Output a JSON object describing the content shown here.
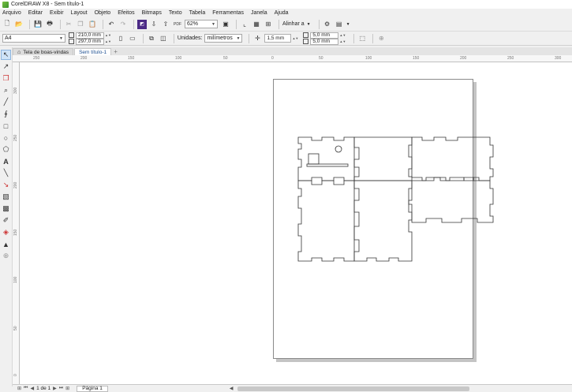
{
  "window": {
    "title": "CorelDRAW X8 - Sem título-1"
  },
  "menu": [
    "Arquivo",
    "Editar",
    "Exibir",
    "Layout",
    "Objeto",
    "Efeitos",
    "Bitmaps",
    "Texto",
    "Tabela",
    "Ferramentas",
    "Janela",
    "Ajuda"
  ],
  "toolbar": {
    "zoom_value": "62%",
    "align_label": "Alinhar a"
  },
  "property_bar": {
    "page_size": "A4",
    "width": "210,0 mm",
    "height": "297,0 mm",
    "units_label": "Unidades:",
    "units_value": "milímetros",
    "nudge": "1,5 mm",
    "dup_x": "5,0 mm",
    "dup_y": "5,0 mm"
  },
  "tabs": [
    {
      "label": "Tela de boas-vindas",
      "active": false
    },
    {
      "label": "Sem título-1",
      "active": true
    }
  ],
  "ruler_h": [
    "250",
    "200",
    "150",
    "100",
    "50",
    "0",
    "50",
    "100",
    "150",
    "200",
    "250",
    "300"
  ],
  "ruler_v": [
    "300",
    "250",
    "200",
    "150",
    "100",
    "50",
    "0"
  ],
  "status": {
    "page_counter": "1 de 1",
    "page_tab": "Página 1"
  }
}
